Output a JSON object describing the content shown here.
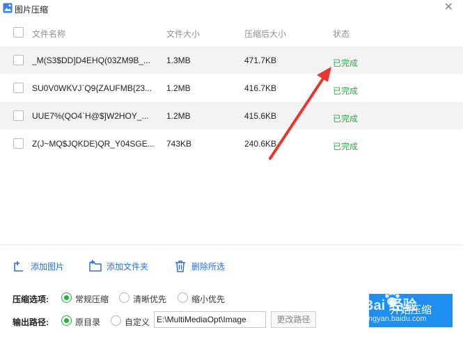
{
  "window": {
    "title": "图片压缩",
    "close_glyph": "✕"
  },
  "table": {
    "headers": {
      "name": "文件名称",
      "size": "文件大小",
      "compressed": "压缩后大小",
      "status": "状态"
    },
    "rows": [
      {
        "name": "_M(S3$DD]D4EHQ(03ZM9B_...",
        "size": "1.3MB",
        "compressed": "471.7KB",
        "status": "已完成"
      },
      {
        "name": "SU0V0WKVJ`Q9{ZAUFMB{23...",
        "size": "1.2MB",
        "compressed": "416.7KB",
        "status": "已完成"
      },
      {
        "name": "UUE7%(QO4`H@$]W2HOY_...",
        "size": "1.2MB",
        "compressed": "415.6KB",
        "status": "已完成"
      },
      {
        "name": "Z(J~MQ$JQKDE)QR_Y04SGE...",
        "size": "743KB",
        "compressed": "240.6KB",
        "status": "已完成"
      }
    ]
  },
  "actions": {
    "add_image": "添加图片",
    "add_folder": "添加文件夹",
    "delete_selected": "删除所选"
  },
  "options": {
    "compress_label": "压缩选项:",
    "compress_modes": [
      "常规压缩",
      "清晰优先",
      "缩小优先"
    ],
    "compress_selected": "常规压缩",
    "output_label": "输出路径:",
    "output_modes": [
      "原目录",
      "自定义"
    ],
    "output_selected": "原目录",
    "path_value": "E:\\MultiMediaOpt\\Image",
    "change_path": "更改路径"
  },
  "start_button": "开始压缩",
  "watermark": {
    "brand": "Bai 经验",
    "url": "jingyan.baidu.com"
  },
  "colors": {
    "accent": "#1e8ff0",
    "success": "#1db43c",
    "link": "#2b6fd6",
    "arrow": "#e8352e"
  }
}
